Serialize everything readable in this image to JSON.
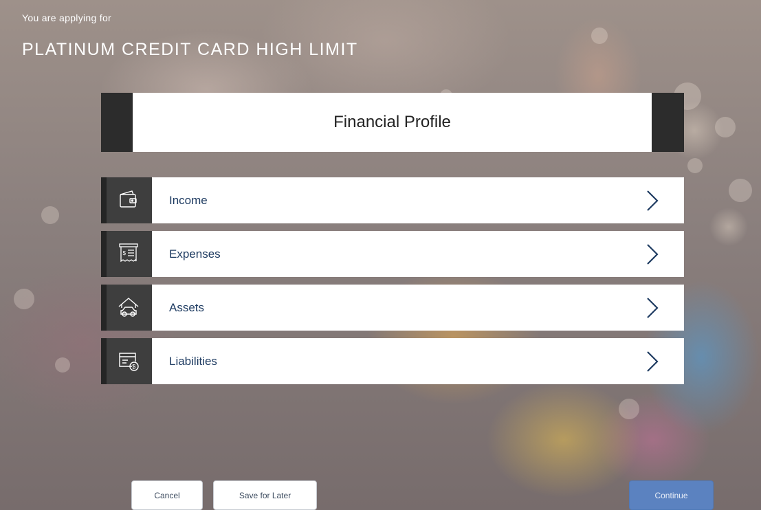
{
  "header": {
    "applying_text": "You are applying for",
    "product_name": "PLATINUM CREDIT CARD HIGH LIMIT"
  },
  "section": {
    "title": "Financial Profile"
  },
  "items": [
    {
      "label": "Income",
      "icon": "wallet-icon"
    },
    {
      "label": "Expenses",
      "icon": "receipt-icon"
    },
    {
      "label": "Assets",
      "icon": "house-car-icon"
    },
    {
      "label": "Liabilities",
      "icon": "bill-dollar-icon"
    }
  ],
  "buttons": {
    "cancel": "Cancel",
    "save_later": "Save for Later",
    "continue": "Continue"
  },
  "colors": {
    "label": "#1f3c62",
    "icon_bg": "#3e3e3e",
    "primary_button": "#5b82c0"
  }
}
